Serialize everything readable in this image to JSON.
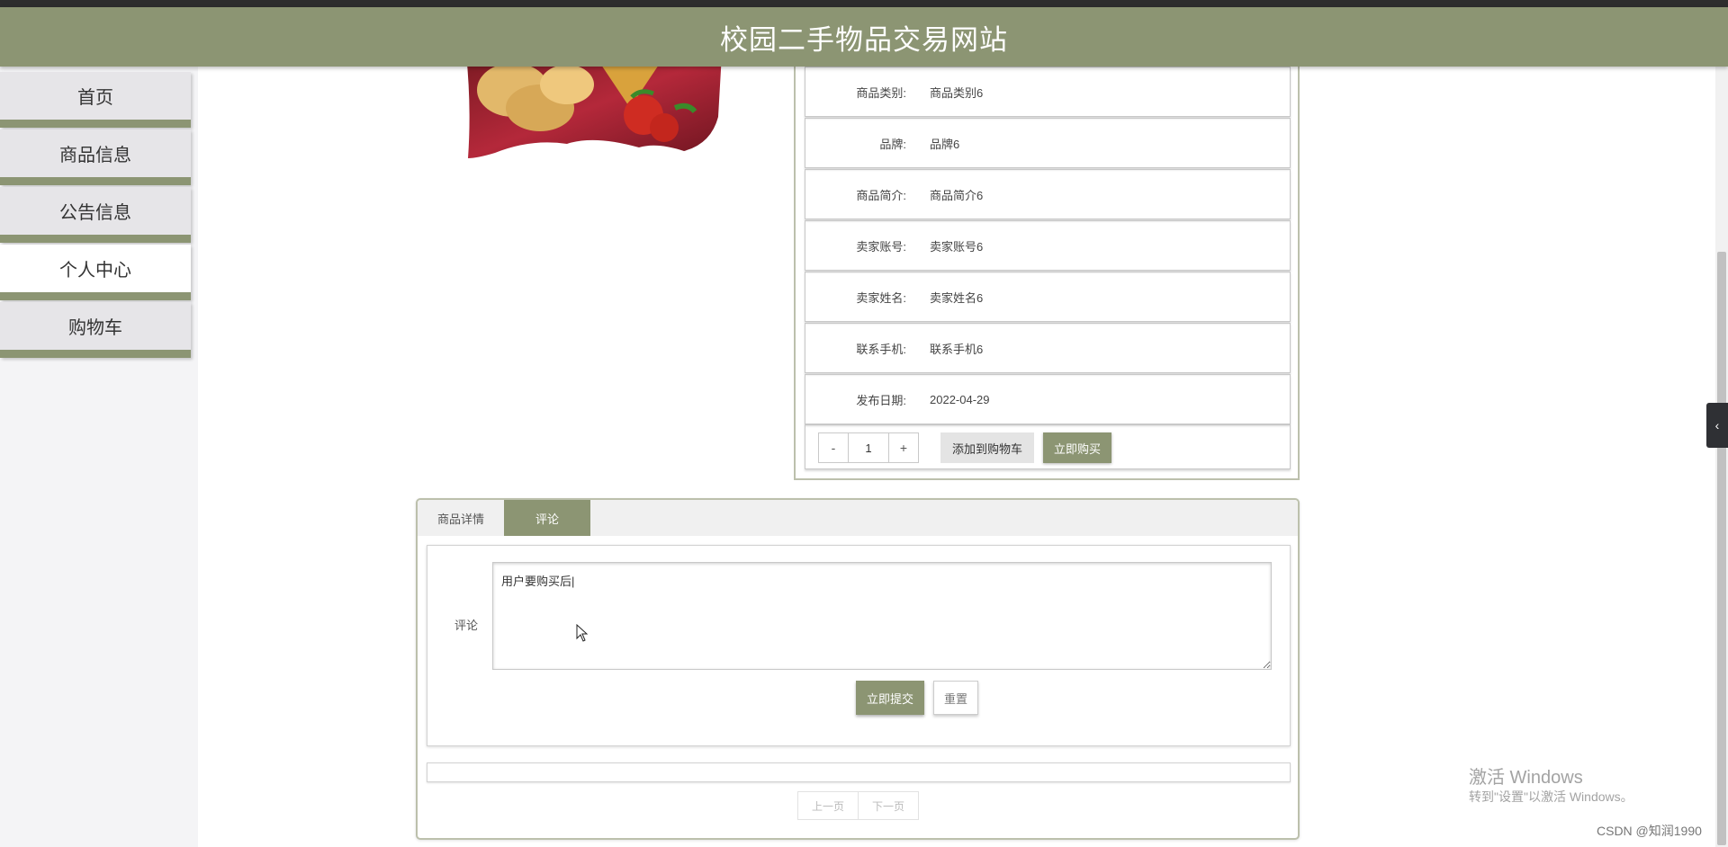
{
  "header": {
    "title": "校园二手物品交易网站"
  },
  "sidebar": {
    "items": [
      {
        "label": "首页",
        "active": false
      },
      {
        "label": "商品信息",
        "active": false
      },
      {
        "label": "公告信息",
        "active": false
      },
      {
        "label": "个人中心",
        "active": true
      },
      {
        "label": "购物车",
        "active": false
      }
    ]
  },
  "product": {
    "image_icon": "potato-chips-bag-image",
    "rows": [
      {
        "label": "商品类别:",
        "value": "商品类别6"
      },
      {
        "label": "品牌:",
        "value": "品牌6"
      },
      {
        "label": "商品简介:",
        "value": "商品简介6"
      },
      {
        "label": "卖家账号:",
        "value": "卖家账号6"
      },
      {
        "label": "卖家姓名:",
        "value": "卖家姓名6"
      },
      {
        "label": "联系手机:",
        "value": "联系手机6"
      },
      {
        "label": "发布日期:",
        "value": "2022-04-29"
      }
    ],
    "quantity": "1",
    "minus_label": "-",
    "plus_label": "+",
    "add_to_cart_label": "添加到购物车",
    "buy_now_label": "立即购买"
  },
  "tabs": [
    {
      "label": "商品详情",
      "active": false
    },
    {
      "label": "评论",
      "active": true
    }
  ],
  "comment_form": {
    "label": "评论",
    "value": "用户要购买后|",
    "submit_label": "立即提交",
    "reset_label": "重置"
  },
  "pagination": {
    "prev_label": "上一页",
    "next_label": "下一页"
  },
  "watermark": {
    "title": "激活 Windows",
    "subtitle": "转到\"设置\"以激活 Windows。"
  },
  "csdn": "CSDN @知润1990",
  "colors": {
    "accent": "#8c9573",
    "sidebar_bg": "#f4f4f6",
    "nav_item_bg": "#e6e5e8"
  }
}
